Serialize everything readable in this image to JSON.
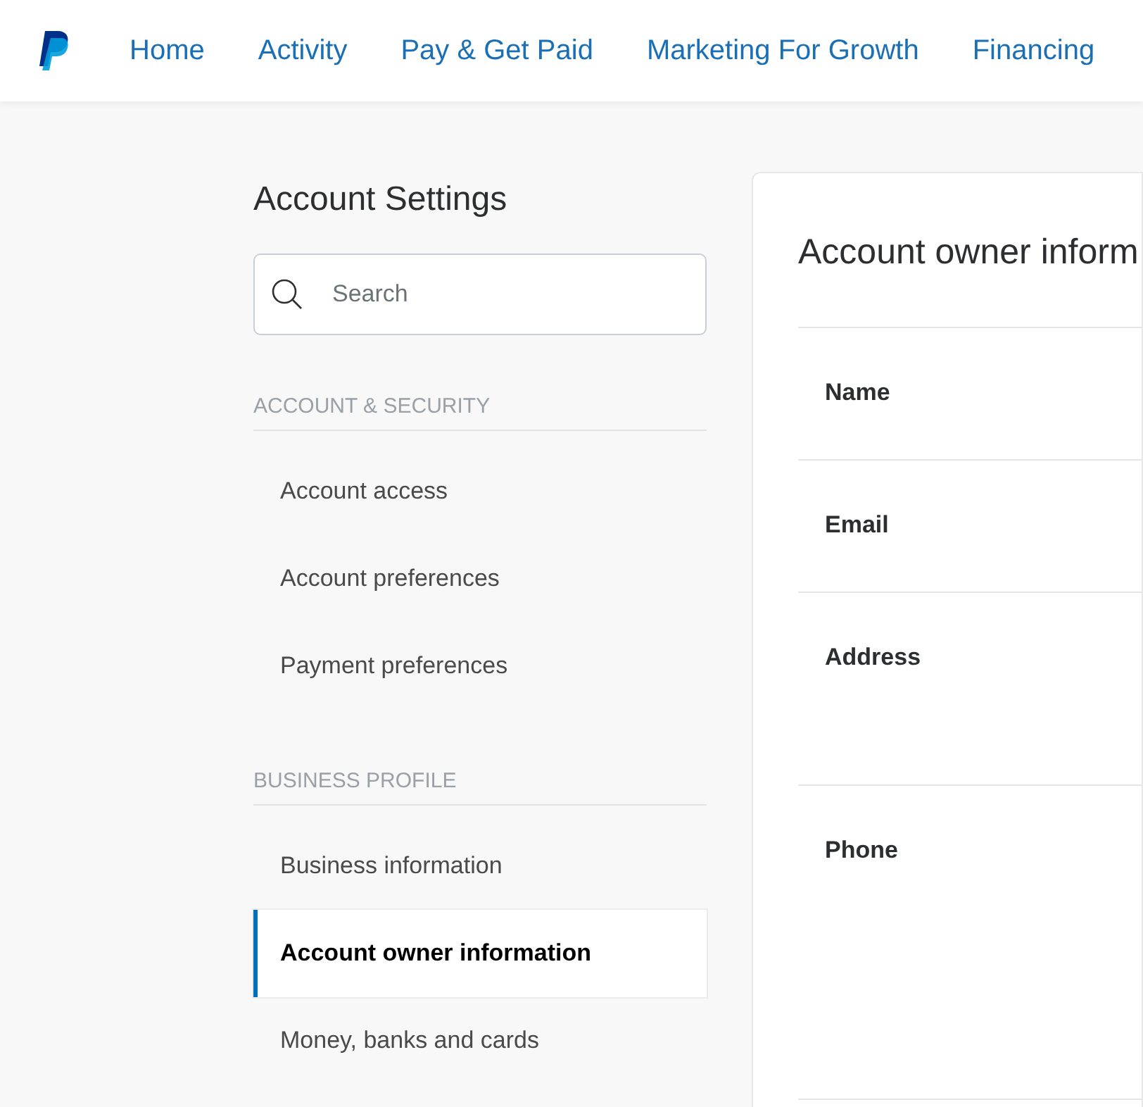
{
  "nav": {
    "items": [
      {
        "label": "Home"
      },
      {
        "label": "Activity"
      },
      {
        "label": "Pay & Get Paid"
      },
      {
        "label": "Marketing For Growth"
      },
      {
        "label": "Financing"
      }
    ]
  },
  "sidebar": {
    "title": "Account Settings",
    "search": {
      "placeholder": "Search"
    },
    "sections": [
      {
        "heading": "ACCOUNT & SECURITY",
        "items": [
          {
            "label": "Account access",
            "selected": false
          },
          {
            "label": "Account preferences",
            "selected": false
          },
          {
            "label": "Payment preferences",
            "selected": false
          }
        ]
      },
      {
        "heading": "BUSINESS PROFILE",
        "items": [
          {
            "label": "Business information",
            "selected": false
          },
          {
            "label": "Account owner information",
            "selected": true
          },
          {
            "label": "Money, banks and cards",
            "selected": false
          }
        ]
      }
    ]
  },
  "panel": {
    "title": "Account owner inform",
    "rows": [
      {
        "label": "Name"
      },
      {
        "label": "Email"
      },
      {
        "label": "Address"
      },
      {
        "label": "Phone"
      }
    ]
  }
}
